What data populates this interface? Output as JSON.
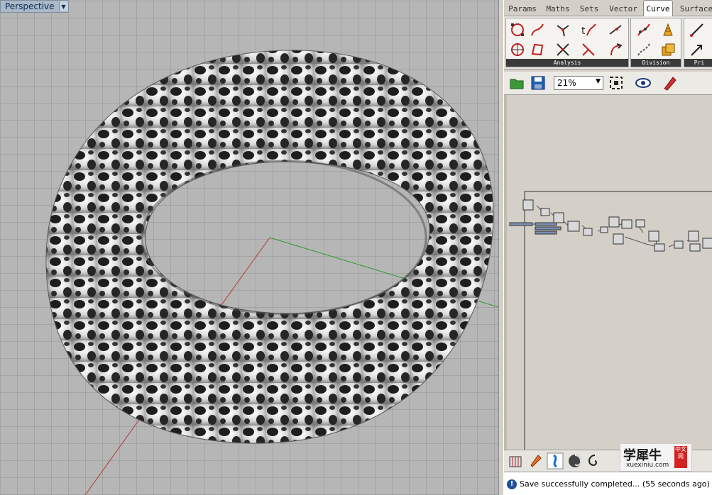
{
  "viewport": {
    "label": "Perspective",
    "dropdown_glyph": "▼"
  },
  "gh": {
    "tabs": [
      "Params",
      "Maths",
      "Sets",
      "Vector",
      "Curve",
      "Surface"
    ],
    "active_tab": "Curve",
    "ribbon_groups": [
      "Analysis",
      "Division",
      "Pri"
    ],
    "zoom": "21%",
    "status": "Save successfully completed... (55 seconds ago)"
  },
  "watermark": {
    "cn": "学犀牛",
    "url": "xuexiniu.com",
    "badge": "中文网"
  },
  "icons": {
    "open": "open-folder-icon",
    "save": "save-icon",
    "zoom-extents": "zoom-extents-icon",
    "preview": "eye-icon",
    "sketch": "pen-icon",
    "info": "info-icon"
  }
}
